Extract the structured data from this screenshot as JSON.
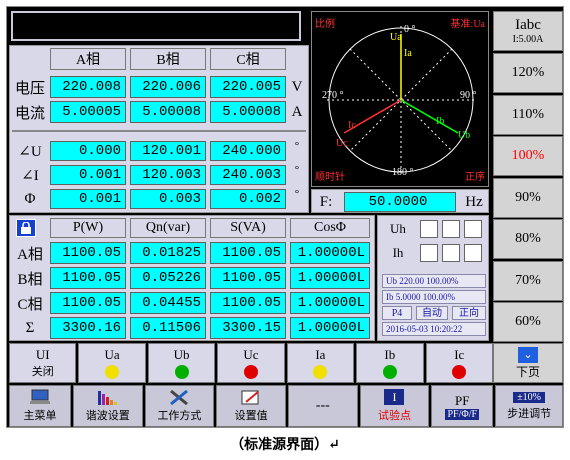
{
  "top_display": "",
  "phasor": {
    "label_ratio": "比例",
    "label_ref": "基准:Ua",
    "deg0": "0 °",
    "deg90": "90 °",
    "deg180": "180 °",
    "deg270": "270 °",
    "label_cw": "顺时针",
    "label_seq": "正序",
    "ua": "Ua",
    "ub": "Ub",
    "uc": "Uc",
    "ia": "Ia",
    "ib": "Ib",
    "ic": "Ic"
  },
  "freq": {
    "label": "F:",
    "value": "50.0000",
    "unit": "Hz"
  },
  "right_buttons": {
    "iabc": "Iabc",
    "range": "I:5.00A",
    "pcts": [
      "120%",
      "110%",
      "100%",
      "90%",
      "80%",
      "70%",
      "60%"
    ],
    "page_down": "下页",
    "active_color": "#ff0000"
  },
  "measure": {
    "headers": [
      "A相",
      "B相",
      "C相"
    ],
    "voltage": {
      "label": "电压",
      "values": [
        "220.008",
        "220.006",
        "220.005"
      ],
      "unit": "V"
    },
    "current": {
      "label": "电流",
      "values": [
        "5.00005",
        "5.00008",
        "5.00008"
      ],
      "unit": "A"
    },
    "angle_u": {
      "label": "∠U",
      "values": [
        "0.000",
        "120.001",
        "240.000"
      ],
      "unit": "°"
    },
    "angle_i": {
      "label": "∠I",
      "values": [
        "0.001",
        "120.003",
        "240.003"
      ],
      "unit": "°"
    },
    "phi": {
      "label": "Φ",
      "values": [
        "0.001",
        "0.003",
        "0.002"
      ],
      "unit": "°"
    }
  },
  "power": {
    "headers": [
      "P(W)",
      "Qn(var)",
      "S(VA)",
      "CosΦ"
    ],
    "rows": [
      {
        "label": "A相",
        "values": [
          "1100.05",
          "0.01825",
          "1100.05",
          "1.00000L"
        ]
      },
      {
        "label": "B相",
        "values": [
          "1100.05",
          "0.05226",
          "1100.05",
          "1.00000L"
        ]
      },
      {
        "label": "C相",
        "values": [
          "1100.05",
          "0.04455",
          "1100.05",
          "1.00000L"
        ]
      },
      {
        "label": "Σ",
        "values": [
          "3300.16",
          "0.11506",
          "3300.15",
          "1.00000L"
        ]
      }
    ]
  },
  "harm": {
    "uh": "Uh",
    "ih": "Ih"
  },
  "info": {
    "ub": "Ub 220.00 100.00%",
    "ib": "Ib 5.0000 100.00%",
    "p4": "P4",
    "auto": "自动",
    "fwd": "正向",
    "datetime": "2016-05-03 10:20:22"
  },
  "switches": [
    {
      "title": "UI",
      "sub": "关闭",
      "color": ""
    },
    {
      "title": "Ua",
      "sub": "",
      "color": "#f0e000"
    },
    {
      "title": "Ub",
      "sub": "",
      "color": "#00b000"
    },
    {
      "title": "Uc",
      "sub": "",
      "color": "#e00000"
    },
    {
      "title": "Ia",
      "sub": "",
      "color": "#f0e000"
    },
    {
      "title": "Ib",
      "sub": "",
      "color": "#00b000"
    },
    {
      "title": "Ic",
      "sub": "",
      "color": "#e00000"
    }
  ],
  "bottom": {
    "main_menu": "主菜单",
    "harmonic": "谐波设置",
    "work_mode": "工作方式",
    "set_value": "设置值",
    "dashes": "---",
    "test_point_icon": "I",
    "test_point": "试验点",
    "pf": "PF",
    "pf_sub": "PF/Φ/F",
    "step": "±10%",
    "step_label": "步进调节"
  },
  "caption": "（标准源界面）↵"
}
